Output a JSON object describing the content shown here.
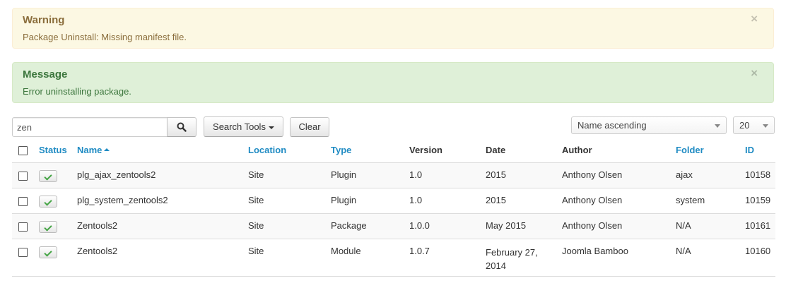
{
  "alerts": {
    "warning": {
      "title": "Warning",
      "text": "Package Uninstall: Missing manifest file.",
      "close": "×"
    },
    "message": {
      "title": "Message",
      "text": "Error uninstalling package.",
      "close": "×"
    }
  },
  "filters": {
    "search_value": "zen",
    "search_tools_label": "Search Tools",
    "clear_label": "Clear",
    "ordering_selected": "Name ascending",
    "limit_selected": "20"
  },
  "table": {
    "headers": {
      "status": "Status",
      "name": "Name",
      "location": "Location",
      "type": "Type",
      "version": "Version",
      "date": "Date",
      "author": "Author",
      "folder": "Folder",
      "id": "ID"
    },
    "rows": [
      {
        "name": "plg_ajax_zentools2",
        "location": "Site",
        "type": "Plugin",
        "version": "1.0",
        "date": "2015",
        "author": "Anthony Olsen",
        "folder": "ajax",
        "id": "10158"
      },
      {
        "name": "plg_system_zentools2",
        "location": "Site",
        "type": "Plugin",
        "version": "1.0",
        "date": "2015",
        "author": "Anthony Olsen",
        "folder": "system",
        "id": "10159"
      },
      {
        "name": "Zentools2",
        "location": "Site",
        "type": "Package",
        "version": "1.0.0",
        "date": "May 2015",
        "author": "Anthony Olsen",
        "folder": "N/A",
        "id": "10161"
      },
      {
        "name": "Zentools2",
        "location": "Site",
        "type": "Module",
        "version": "1.0.7",
        "date": "February 27, 2014",
        "author": "Joomla Bamboo",
        "folder": "N/A",
        "id": "10160"
      }
    ]
  },
  "colors": {
    "link": "#1f8bc3",
    "check": "#46a546",
    "warning_text": "#8a6d3b",
    "success_text": "#3c763d"
  }
}
